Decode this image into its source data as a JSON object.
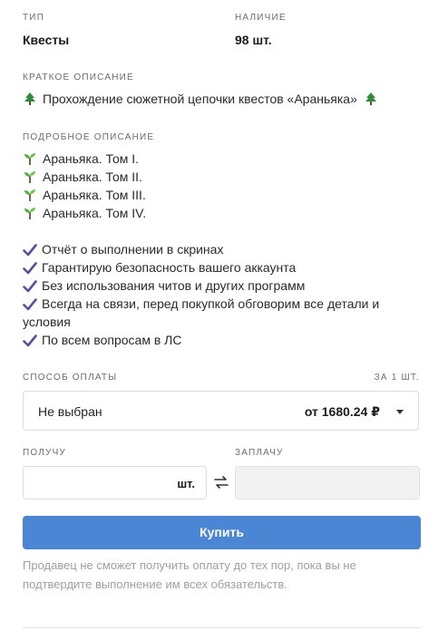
{
  "type": {
    "label": "ТИП",
    "value": "Квесты"
  },
  "availability": {
    "label": "НАЛИЧИЕ",
    "value": "98 шт."
  },
  "short_description": {
    "label": "КРАТКОЕ ОПИСАНИЕ",
    "text": "Прохождение сюжетной цепочки квестов «Араньяка»"
  },
  "detailed_description": {
    "label": "ПОДРОБНОЕ ОПИСАНИЕ",
    "volumes": [
      "Араньяка. Том I.",
      "Араньяка. Том II.",
      "Араньяка. Том III.",
      "Араньяка. Том IV."
    ],
    "features": [
      "Отчёт о выполнении в скринах",
      "Гарантирую безопасность вашего аккаунта",
      "Без использования читов и других программ",
      "Всегда на связи, перед покупкой обговорим все детали и условия",
      "По всем вопросам в ЛС"
    ]
  },
  "payment": {
    "label": "СПОСОБ ОПЛАТЫ",
    "per_unit_label": "ЗА 1 ШТ.",
    "selected": "Не выбран",
    "price": "от 1680.24 ₽"
  },
  "receive": {
    "label": "ПОЛУЧУ",
    "unit": "шт.",
    "value": ""
  },
  "pay_amount": {
    "label": "ЗАПЛАЧУ",
    "value": ""
  },
  "buy_button": "Купить",
  "note": "Продавец не сможет получить оплату до тех пор, пока вы не подтвердите выполнение им всех обязательств.",
  "colors": {
    "accent": "#4a86d4",
    "check": "#5a4f9e",
    "tree": "#2e8b3a"
  },
  "icons": {
    "tree": "tree-icon",
    "sprout": "sprout-icon",
    "check": "check-icon",
    "caret": "caret-down-icon",
    "swap": "swap-icon"
  }
}
